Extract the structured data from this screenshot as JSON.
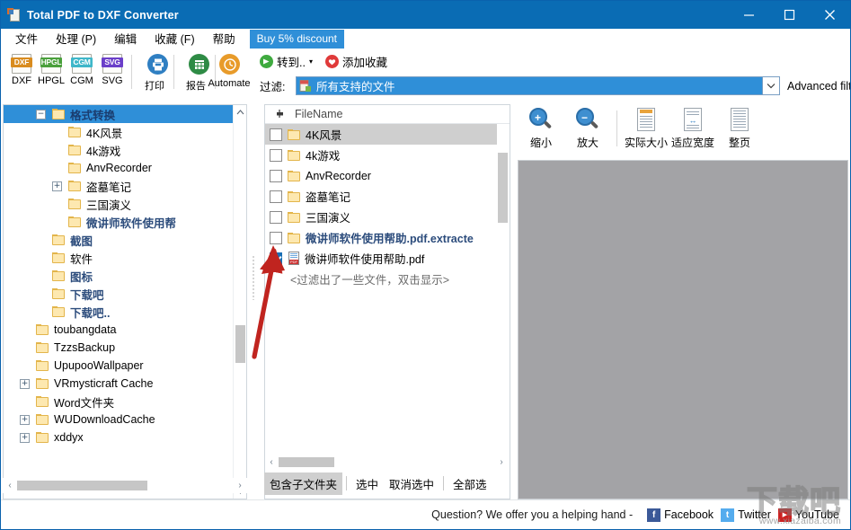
{
  "window": {
    "title": "Total PDF to DXF Converter",
    "icon": "pdf-document-icon",
    "minimize": "minimize-icon",
    "maximize": "maximize-icon",
    "close": "close-icon"
  },
  "menu": {
    "items": [
      "文件",
      "处理 (P)",
      "编辑",
      "收藏 (F)",
      "帮助"
    ],
    "promo": "Buy 5% discount"
  },
  "toolbar": {
    "formats": [
      {
        "label": "DXF",
        "tag": "DXF",
        "color": "#d98c1f"
      },
      {
        "label": "HPGL",
        "tag": "HPGL",
        "color": "#4aa03c"
      },
      {
        "label": "CGM",
        "tag": "CGM",
        "color": "#3fb7c9"
      },
      {
        "label": "SVG",
        "tag": "SVG",
        "color": "#6b3fc9"
      }
    ],
    "print": {
      "label": "打印",
      "icon": "printer-icon",
      "color": "#2f7fc2"
    },
    "report": {
      "label": "报告",
      "icon": "report-icon",
      "color": "#2e8b45"
    },
    "automate": {
      "label": "Automate",
      "icon": "clock-icon",
      "color": "#e89b2a"
    },
    "goto": {
      "label": "转到..",
      "icon": "green-arrow-icon",
      "color": "#3faa3f"
    },
    "add_favorite": {
      "label": "添加收藏",
      "icon": "heart-icon",
      "color": "#e03a3a"
    }
  },
  "filter": {
    "label": "过滤:",
    "value": "所有支持的文件",
    "icon": "file-type-icon",
    "dropdown": "chevron-down-icon",
    "advanced": "Advanced filter"
  },
  "tree": {
    "items": [
      {
        "label": "格式转换",
        "indent": 3,
        "selected": true,
        "expander": "−",
        "bold": true
      },
      {
        "label": "4K风景",
        "indent": 4,
        "selected": false,
        "expander": ""
      },
      {
        "label": "4k游戏",
        "indent": 4,
        "selected": false,
        "expander": ""
      },
      {
        "label": "AnvRecorder",
        "indent": 4,
        "selected": false,
        "expander": ""
      },
      {
        "label": "盗墓笔记",
        "indent": 4,
        "selected": false,
        "expander": "+"
      },
      {
        "label": "三国演义",
        "indent": 4,
        "selected": false,
        "expander": ""
      },
      {
        "label": "微讲师软件使用帮",
        "indent": 4,
        "selected": false,
        "expander": "",
        "bluebold": true
      },
      {
        "label": "截图",
        "indent": 3,
        "selected": false,
        "expander": "",
        "bluebold": true
      },
      {
        "label": "软件",
        "indent": 3,
        "selected": false,
        "expander": ""
      },
      {
        "label": "图标",
        "indent": 3,
        "selected": false,
        "expander": "",
        "bluebold": true
      },
      {
        "label": "下载吧",
        "indent": 3,
        "selected": false,
        "expander": "",
        "bluebold": true
      },
      {
        "label": "下载吧..",
        "indent": 3,
        "selected": false,
        "expander": "",
        "bluebold": true
      },
      {
        "label": "toubangdata",
        "indent": 2,
        "selected": false,
        "expander": ""
      },
      {
        "label": "TzzsBackup",
        "indent": 2,
        "selected": false,
        "expander": ""
      },
      {
        "label": "UpupooWallpaper",
        "indent": 2,
        "selected": false,
        "expander": ""
      },
      {
        "label": "VRmysticraft Cache",
        "indent": 2,
        "selected": false,
        "expander": "+"
      },
      {
        "label": "Word文件夹",
        "indent": 2,
        "selected": false,
        "expander": ""
      },
      {
        "label": "WUDownloadCache",
        "indent": 2,
        "selected": false,
        "expander": "+"
      },
      {
        "label": "xddyx",
        "indent": 2,
        "selected": false,
        "expander": "+"
      }
    ],
    "scroll_up": "chevron-up-icon",
    "scroll_down": "chevron-down-icon",
    "hscroll_left": "chevron-left-icon",
    "hscroll_right": "chevron-right-icon",
    "zoom_out": "−",
    "zoom_in": "+"
  },
  "filelist": {
    "header": {
      "label": "FileName",
      "icon": "pin-icon"
    },
    "rows": [
      {
        "name": "4K风景",
        "type": "folder",
        "checked": false,
        "highlighted": true
      },
      {
        "name": "4k游戏",
        "type": "folder",
        "checked": false,
        "highlighted": false
      },
      {
        "name": "AnvRecorder",
        "type": "folder",
        "checked": false,
        "highlighted": false
      },
      {
        "name": "盗墓笔记",
        "type": "folder",
        "checked": false,
        "highlighted": false
      },
      {
        "name": "三国演义",
        "type": "folder",
        "checked": false,
        "highlighted": false
      },
      {
        "name": "微讲师软件使用帮助.pdf.extracte",
        "type": "folder",
        "checked": false,
        "highlighted": false,
        "bluebold": true
      },
      {
        "name": "微讲师软件使用帮助.pdf",
        "type": "pdf",
        "checked": true,
        "highlighted": false
      }
    ],
    "note": "<过滤出了一些文件，双击显示>",
    "buttons": [
      {
        "label": "包含子文件夹",
        "active": true
      },
      {
        "label": "选中",
        "active": false
      },
      {
        "label": "取消选中",
        "active": false
      },
      {
        "label": "全部选",
        "active": false
      }
    ],
    "hscroll_left": "chevron-left-icon",
    "hscroll_right": "chevron-right-icon"
  },
  "preview": {
    "tools": [
      {
        "label": "缩小",
        "icon": "zoom-out-icon",
        "sign": "+"
      },
      {
        "label": "放大",
        "icon": "zoom-in-icon",
        "sign": "−"
      },
      {
        "label": "实际大小",
        "icon": "actual-size-icon"
      },
      {
        "label": "适应宽度",
        "icon": "fit-width-icon"
      },
      {
        "label": "整页",
        "icon": "whole-page-icon"
      }
    ]
  },
  "status": {
    "question": "Question? We offer you a helping hand -",
    "links": [
      {
        "label": "Facebook",
        "icon": "facebook-icon",
        "color": "#3b5998",
        "glyph": "f"
      },
      {
        "label": "Twitter",
        "icon": "twitter-icon",
        "color": "#55acee",
        "glyph": "t"
      },
      {
        "label": "YouTube",
        "icon": "youtube-icon",
        "color": "#cc2222",
        "glyph": "▶"
      }
    ]
  },
  "watermark": {
    "cn": "下载吧",
    "url": "www.xiazaiba.com"
  }
}
